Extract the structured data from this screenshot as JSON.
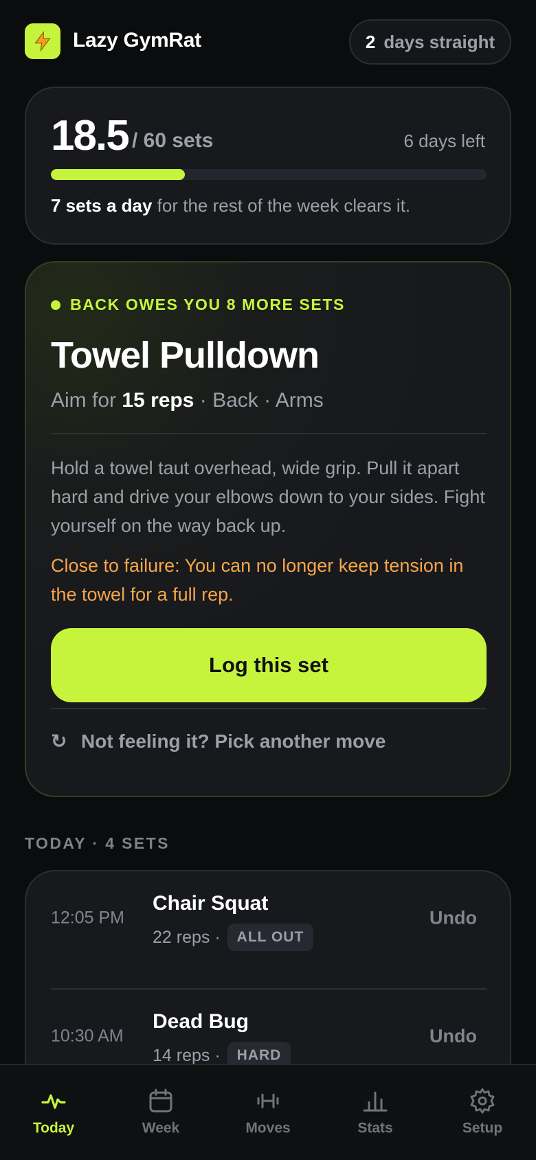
{
  "app": {
    "title": "Lazy GymRat",
    "logo_icon": "lightning-bolt-icon",
    "accent": "#c6f43c"
  },
  "streak": {
    "count": "2",
    "label": "days straight"
  },
  "progress": {
    "done": "18.5",
    "goal_text": "/ 60 sets",
    "days_left": "6 days left",
    "fraction": 0.308,
    "pace_strong": "7 sets a day",
    "pace_rest": " for the rest of the week clears it."
  },
  "suggestion": {
    "owe_text": "BACK OWES YOU 8 MORE SETS",
    "move_name": "Towel Pulldown",
    "aim_prefix": "Aim for ",
    "aim_reps": "15 reps",
    "aim_suffix": " · Back · Arms",
    "description": "Hold a towel taut overhead, wide grip. Pull it apart hard and drive your elbows down to your sides. Fight yourself on the way back up.",
    "failure_cue": "Close to failure: You can no longer keep tension in the towel for a full rep.",
    "log_button": "Log this set",
    "swap_icon": "refresh-icon",
    "swap_label": "Not feeling it? Pick another move"
  },
  "today": {
    "header": "TODAY · 4 SETS",
    "entries": [
      {
        "time": "12:05 PM",
        "name": "Chair Squat",
        "reps": "22 reps ·",
        "effort": "ALL OUT",
        "undo": "Undo"
      },
      {
        "time": "10:30 AM",
        "name": "Dead Bug",
        "reps": "14 reps ·",
        "effort": "HARD",
        "undo": "Undo"
      }
    ]
  },
  "nav": {
    "items": [
      {
        "label": "Today",
        "icon": "pulse-icon",
        "active": true
      },
      {
        "label": "Week",
        "icon": "calendar-icon",
        "active": false
      },
      {
        "label": "Moves",
        "icon": "dumbbell-icon",
        "active": false
      },
      {
        "label": "Stats",
        "icon": "bar-chart-icon",
        "active": false
      },
      {
        "label": "Setup",
        "icon": "gear-icon",
        "active": false
      }
    ]
  }
}
